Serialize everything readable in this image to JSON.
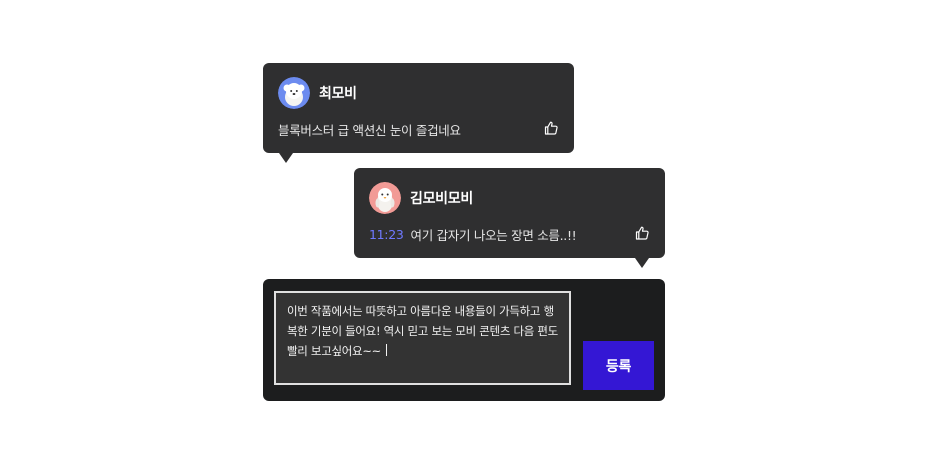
{
  "comments": [
    {
      "username": "최모비",
      "timestamp": "",
      "text": "블록버스터 급 액션신 눈이 즐겁네요",
      "avatar_icon": "dog-avatar-icon",
      "avatar_bg": "#6c8bef",
      "like_icon": "thumbs-up-icon"
    },
    {
      "username": "김모비모비",
      "timestamp": "11:23",
      "text": "여기 갑자기 나오는 장면 소름..!!",
      "avatar_icon": "penguin-avatar-icon",
      "avatar_bg": "#f29b96",
      "like_icon": "thumbs-up-icon"
    }
  ],
  "composer": {
    "input_value": "이번 작품에서는 따뜻하고 아름다운 내용들이 가득하고 행복한 기분이 들어요! 역시 믿고 보는 모비 콘텐츠 다음 편도 빨리 보고싶어요~~ ",
    "submit_label": "등록"
  },
  "colors": {
    "bubble_bg": "#2f2f30",
    "composer_bg": "#1c1d1e",
    "accent": "#3417d4",
    "timestamp": "#6f79ff"
  }
}
